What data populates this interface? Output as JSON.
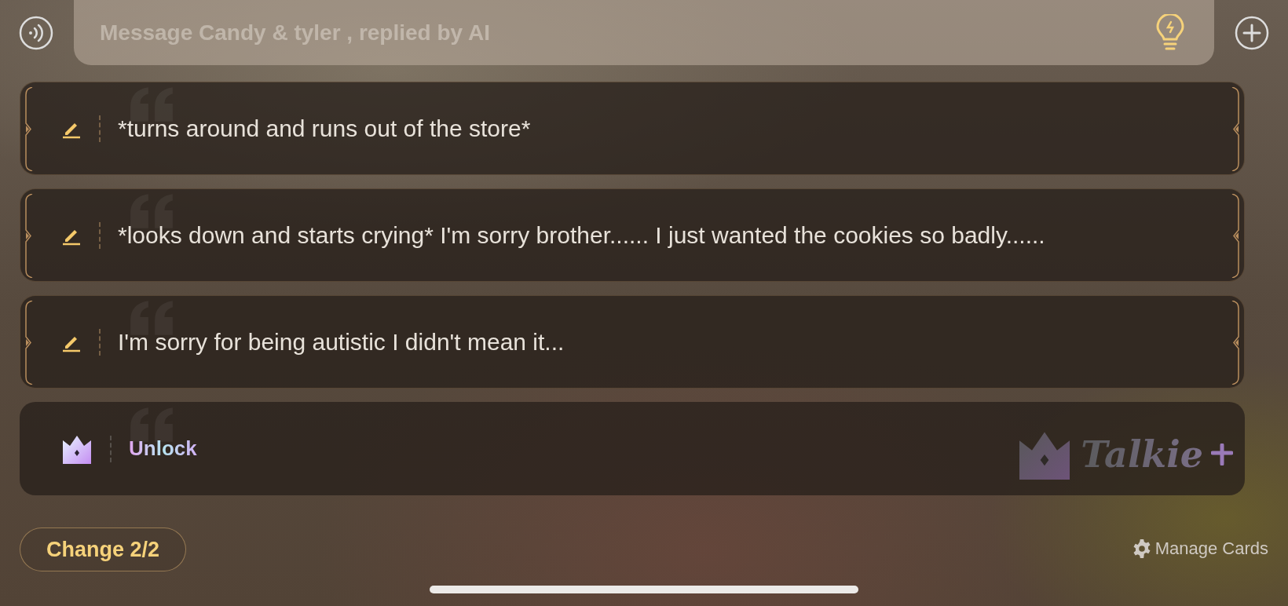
{
  "message_input": {
    "placeholder": "Message Candy & tyler , replied by AI"
  },
  "cards": [
    {
      "kind": "reply",
      "text": "*turns around and runs out of the store*"
    },
    {
      "kind": "reply",
      "text": "*looks down and starts crying* I'm sorry brother...... I just wanted the cookies so badly......"
    },
    {
      "kind": "reply",
      "text": "I'm sorry for being autistic I didn't mean it..."
    },
    {
      "kind": "locked",
      "text": "Unlock",
      "brand": "Talkie"
    }
  ],
  "change_button": "Change 2/2",
  "manage_link": "Manage Cards"
}
